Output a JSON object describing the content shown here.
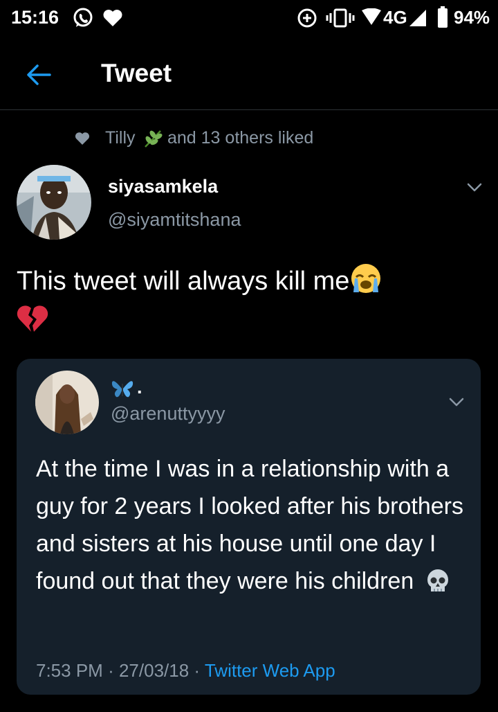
{
  "status_bar": {
    "time": "15:16",
    "network": "4G",
    "battery": "94%"
  },
  "header": {
    "title": "Tweet"
  },
  "liked_row": {
    "first_name": "Tilly",
    "rest": "and 13 others liked"
  },
  "author": {
    "name": "siyasamkela",
    "handle": "@siyamtitshana"
  },
  "tweet": {
    "text": "This tweet will always kill me"
  },
  "quoted_tweet": {
    "name_suffix": ".",
    "handle": "@arenuttyyyy",
    "text": "At the time I was in a relationship with a guy for 2 years I looked after his brothers and sisters at his house until one day I found out that they were his children",
    "time": "7:53 PM",
    "sep": "·",
    "date": "27/03/18",
    "source": "Twitter Web App"
  },
  "colors": {
    "background": "#000000",
    "card": "#15202b",
    "accent": "#1d9bf0",
    "muted": "#8b98a5"
  },
  "icons": [
    "whatsapp-icon",
    "heart-icon",
    "data-saver-icon",
    "vibrate-icon",
    "wifi-icon",
    "signal-icon",
    "battery-icon",
    "back-arrow-icon",
    "liked-heart-icon",
    "herb-emoji-icon",
    "chevron-down-icon",
    "crying-face-emoji-icon",
    "broken-heart-emoji-icon",
    "butterfly-emoji-icon",
    "skull-emoji-icon"
  ]
}
